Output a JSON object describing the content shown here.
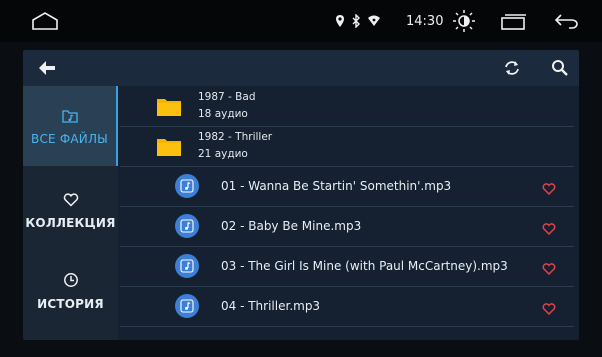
{
  "status": {
    "time": "14:30"
  },
  "sidebar": {
    "items": [
      {
        "label": "ВСЕ ФАЙЛЫ",
        "icon": "music-folder-icon",
        "active": true
      },
      {
        "label": "КОЛЛЕКЦИЯ",
        "icon": "heart-outline-icon",
        "active": false
      },
      {
        "label": "ИСТОРИЯ",
        "icon": "clock-icon",
        "active": false
      }
    ]
  },
  "folders": [
    {
      "name": "1987 - Bad",
      "count": "18 аудио"
    },
    {
      "name": "1982 - Thriller",
      "count": "21 аудио"
    }
  ],
  "tracks": [
    {
      "title": "01 - Wanna Be Startin' Somethin'.mp3"
    },
    {
      "title": "02 - Baby Be Mine.mp3"
    },
    {
      "title": "03 - The Girl Is Mine (with Paul McCartney).mp3"
    },
    {
      "title": "04 - Thriller.mp3"
    }
  ],
  "colors": {
    "accent": "#3aa0e0",
    "heart": "#e0404a",
    "note": "#3d7fd6",
    "folder": "#f5b400"
  }
}
